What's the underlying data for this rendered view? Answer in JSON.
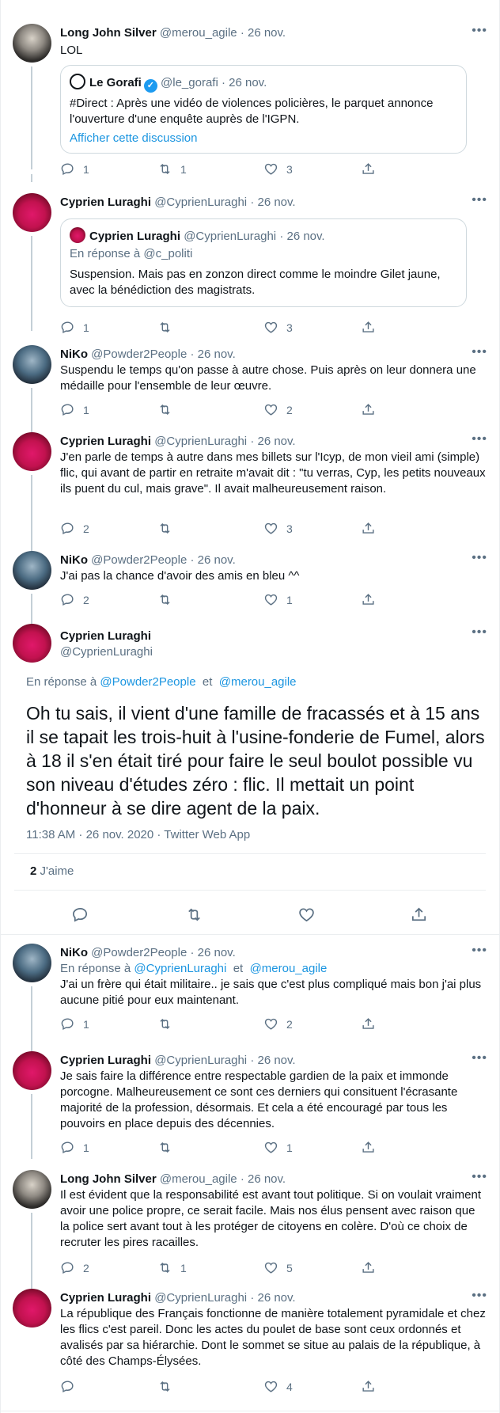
{
  "tweets": [
    {
      "name": "Long John Silver",
      "handle": "@merou_agile",
      "date": "· 26 nov.",
      "text": "LOL",
      "quote": {
        "name": "Le Gorafi",
        "handle": "@le_gorafi",
        "date": "· 26 nov.",
        "text": "#Direct : Après une vidéo de violences policières, le parquet annonce l'ouverture d'une enquête auprès de l'IGPN.",
        "link": "Afficher cette discussion"
      },
      "replies": "1",
      "retweets": "1",
      "likes": "3"
    },
    {
      "name": "Cyprien Luraghi",
      "handle": "@CyprienLuraghi",
      "date": "· 26 nov.",
      "quote": {
        "name": "Cyprien Luraghi",
        "handle": "@CyprienLuraghi",
        "date": "· 26 nov.",
        "reply_prefix": "En réponse à",
        "reply_handle": "@c_politi",
        "text": "Suspension. Mais pas en zonzon direct comme le moindre Gilet jaune, avec la bénédiction des magistrats."
      },
      "replies": "1",
      "retweets": "",
      "likes": "3"
    },
    {
      "name": "NiKo",
      "handle": "@Powder2People",
      "date": "· 26 nov.",
      "text": "Suspendu le temps qu'on passe à autre chose. Puis après on leur donnera une médaille pour l'ensemble de leur œuvre.",
      "replies": "1",
      "retweets": "",
      "likes": "2"
    },
    {
      "name": "Cyprien Luraghi",
      "handle": "@CyprienLuraghi",
      "date": "· 26 nov.",
      "text": "J'en parle de temps à autre dans mes billets sur l'Icyp, de mon vieil ami (simple) flic, qui avant de partir en retraite m'avait dit : \"tu verras, Cyp, les petits nouveaux ils puent du cul, mais grave\". Il avait malheureusement raison.",
      "replies": "2",
      "retweets": "",
      "likes": "3"
    },
    {
      "name": "NiKo",
      "handle": "@Powder2People",
      "date": "· 26 nov.",
      "text": "J'ai pas la chance d'avoir des amis en bleu ^^",
      "replies": "2",
      "retweets": "",
      "likes": "1"
    }
  ],
  "main": {
    "name": "Cyprien Luraghi",
    "handle": "@CyprienLuraghi",
    "reply_prefix": "En réponse à",
    "reply_handle_1": "@Powder2People",
    "reply_and": "et",
    "reply_handle_2": "@merou_agile",
    "text": "Oh tu sais, il vient d'une famille de fracassés et à 15 ans il se tapait les trois-huit à l'usine-fonderie de Fumel, alors à 18 il s'en était tiré pour faire le seul boulot possible vu son niveau d'études zéro : flic. Il mettait un point d'honneur à se dire agent de la paix.",
    "meta": "11:38 AM · 26 nov. 2020 · Twitter Web App",
    "likes_count": "2",
    "likes_label": "J'aime"
  },
  "replies": [
    {
      "name": "NiKo",
      "handle": "@Powder2People",
      "date": "· 26 nov.",
      "reply_prefix": "En réponse à",
      "reply_handle_1": "@CyprienLuraghi",
      "reply_and": "et",
      "reply_handle_2": "@merou_agile",
      "text": "J'ai un frère qui était militaire.. je sais que c'est plus compliqué mais bon j'ai plus aucune pitié pour eux maintenant.",
      "replies": "1",
      "retweets": "",
      "likes": "2"
    },
    {
      "name": "Cyprien Luraghi",
      "handle": "@CyprienLuraghi",
      "date": "· 26 nov.",
      "text": "Je sais faire la différence entre respectable gardien de la paix et immonde porcogne. Malheureusement ce sont ces derniers qui consituent l'écrasante majorité de la profession, désormais. Et cela a été encouragé par tous les pouvoirs en place depuis des décennies.",
      "replies": "1",
      "retweets": "",
      "likes": "1"
    },
    {
      "name": "Long John Silver",
      "handle": "@merou_agile",
      "date": "· 26 nov.",
      "text": "Il est évident que la responsabilité est avant tout politique. Si on voulait vraiment avoir une police propre, ce serait facile. Mais nos élus pensent avec raison que la police sert avant tout à les protéger de citoyens en colère. D'où ce choix de recruter les pires racailles.",
      "replies": "2",
      "retweets": "1",
      "likes": "5"
    },
    {
      "name": "Cyprien Luraghi",
      "handle": "@CyprienLuraghi",
      "date": "· 26 nov.",
      "text": "La république des Français fonctionne de manière totalement pyramidale et chez les flics c'est pareil. Donc les actes du poulet de base sont ceux ordonnés et avalisés par sa hiérarchie. Dont le sommet se situe au palais de la république, à côté des Champs-Élysées.",
      "replies": "",
      "retweets": "",
      "likes": "4"
    }
  ],
  "more_glyph": "•••"
}
